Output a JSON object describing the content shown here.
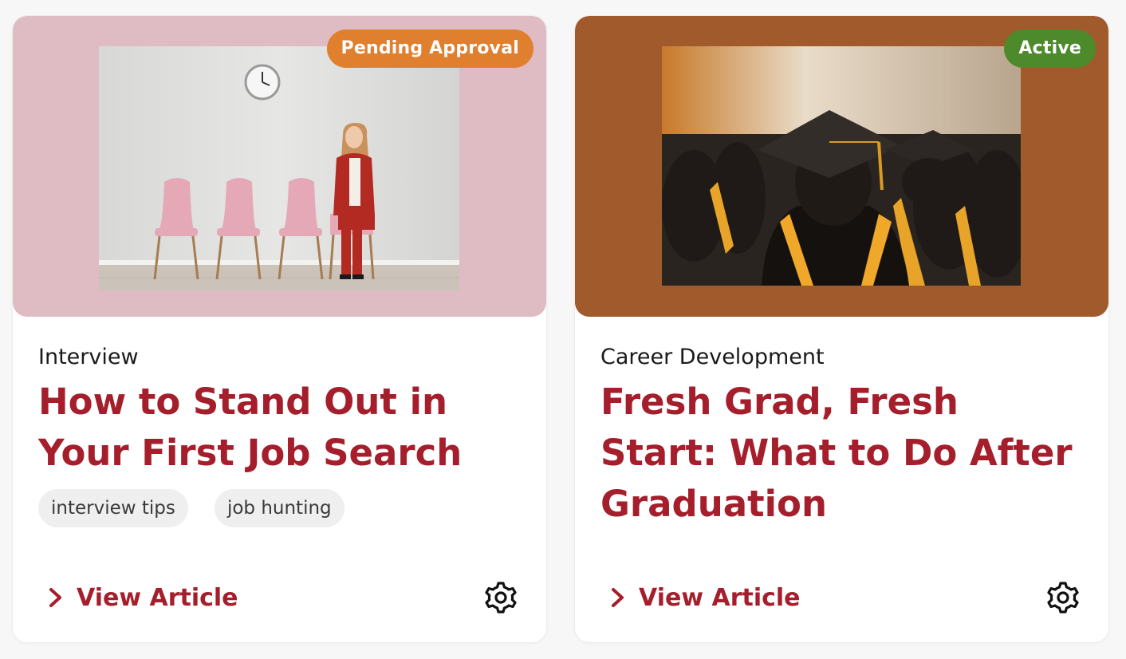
{
  "articles": [
    {
      "status": "Pending Approval",
      "status_color": "#e07f2e",
      "media_bg": "#dfbcc3",
      "category": "Interview",
      "title": "How to Stand Out in Your First Job Search",
      "tags": [
        "interview tips",
        "job hunting"
      ],
      "link_label": "View Article",
      "settings_icon": "gear-icon",
      "link_icon": "chevron-right-icon"
    },
    {
      "status": "Active",
      "status_color": "#4d8a2c",
      "media_bg": "#a05a2c",
      "category": "Career Development",
      "title": "Fresh Grad, Fresh Start: What to Do After Graduation",
      "tags": [],
      "link_label": "View Article",
      "settings_icon": "gear-icon",
      "link_icon": "chevron-right-icon"
    }
  ],
  "colors": {
    "accent": "#a51e2b",
    "tag_bg": "#efefef",
    "page_bg": "#f7f7f7"
  }
}
